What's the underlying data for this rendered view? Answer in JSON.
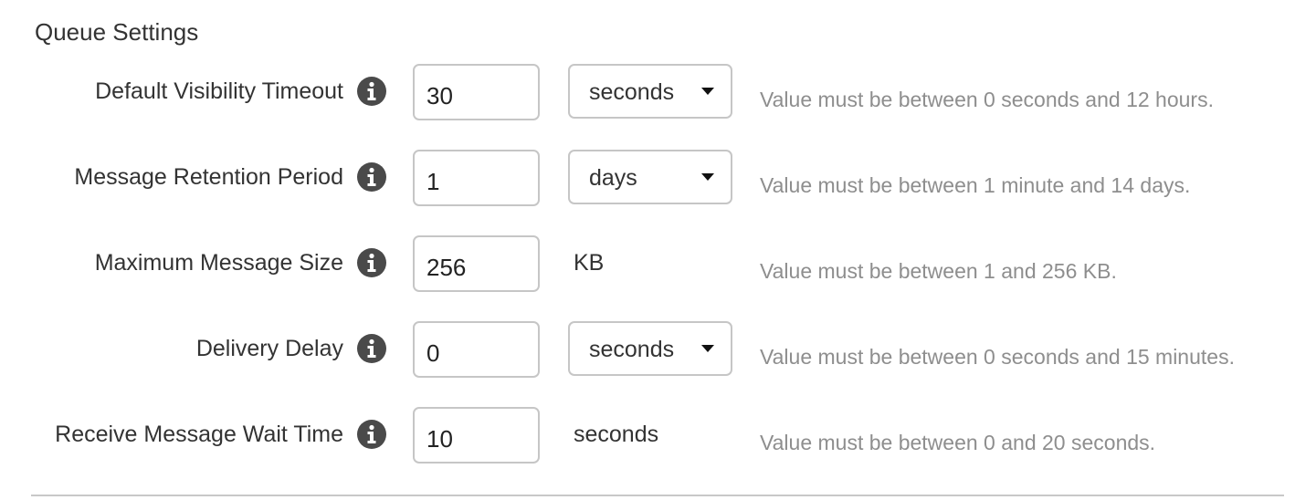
{
  "section": {
    "title": "Queue Settings"
  },
  "rows": [
    {
      "label": "Default Visibility Timeout",
      "value": "30",
      "unit": "seconds",
      "unit_kind": "dropdown",
      "hint": "Value must be between 0 seconds and 12 hours."
    },
    {
      "label": "Message Retention Period",
      "value": "1",
      "unit": "days",
      "unit_kind": "dropdown",
      "hint": "Value must be between 1 minute and 14 days."
    },
    {
      "label": "Maximum Message Size",
      "value": "256",
      "unit": "KB",
      "unit_kind": "static",
      "hint": "Value must be between 1 and 256 KB."
    },
    {
      "label": "Delivery Delay",
      "value": "0",
      "unit": "seconds",
      "unit_kind": "dropdown",
      "hint": "Value must be between 0 seconds and 15 minutes."
    },
    {
      "label": "Receive Message Wait Time",
      "value": "10",
      "unit": "seconds",
      "unit_kind": "static",
      "hint": "Value must be between 0 and 20 seconds."
    }
  ],
  "icons": {
    "info": "info-icon",
    "dropdown": "caret-down-icon"
  },
  "colors": {
    "text": "#333333",
    "hint": "#8e8e8e",
    "border": "#c6c6c6",
    "icon": "#4a4a4a"
  }
}
